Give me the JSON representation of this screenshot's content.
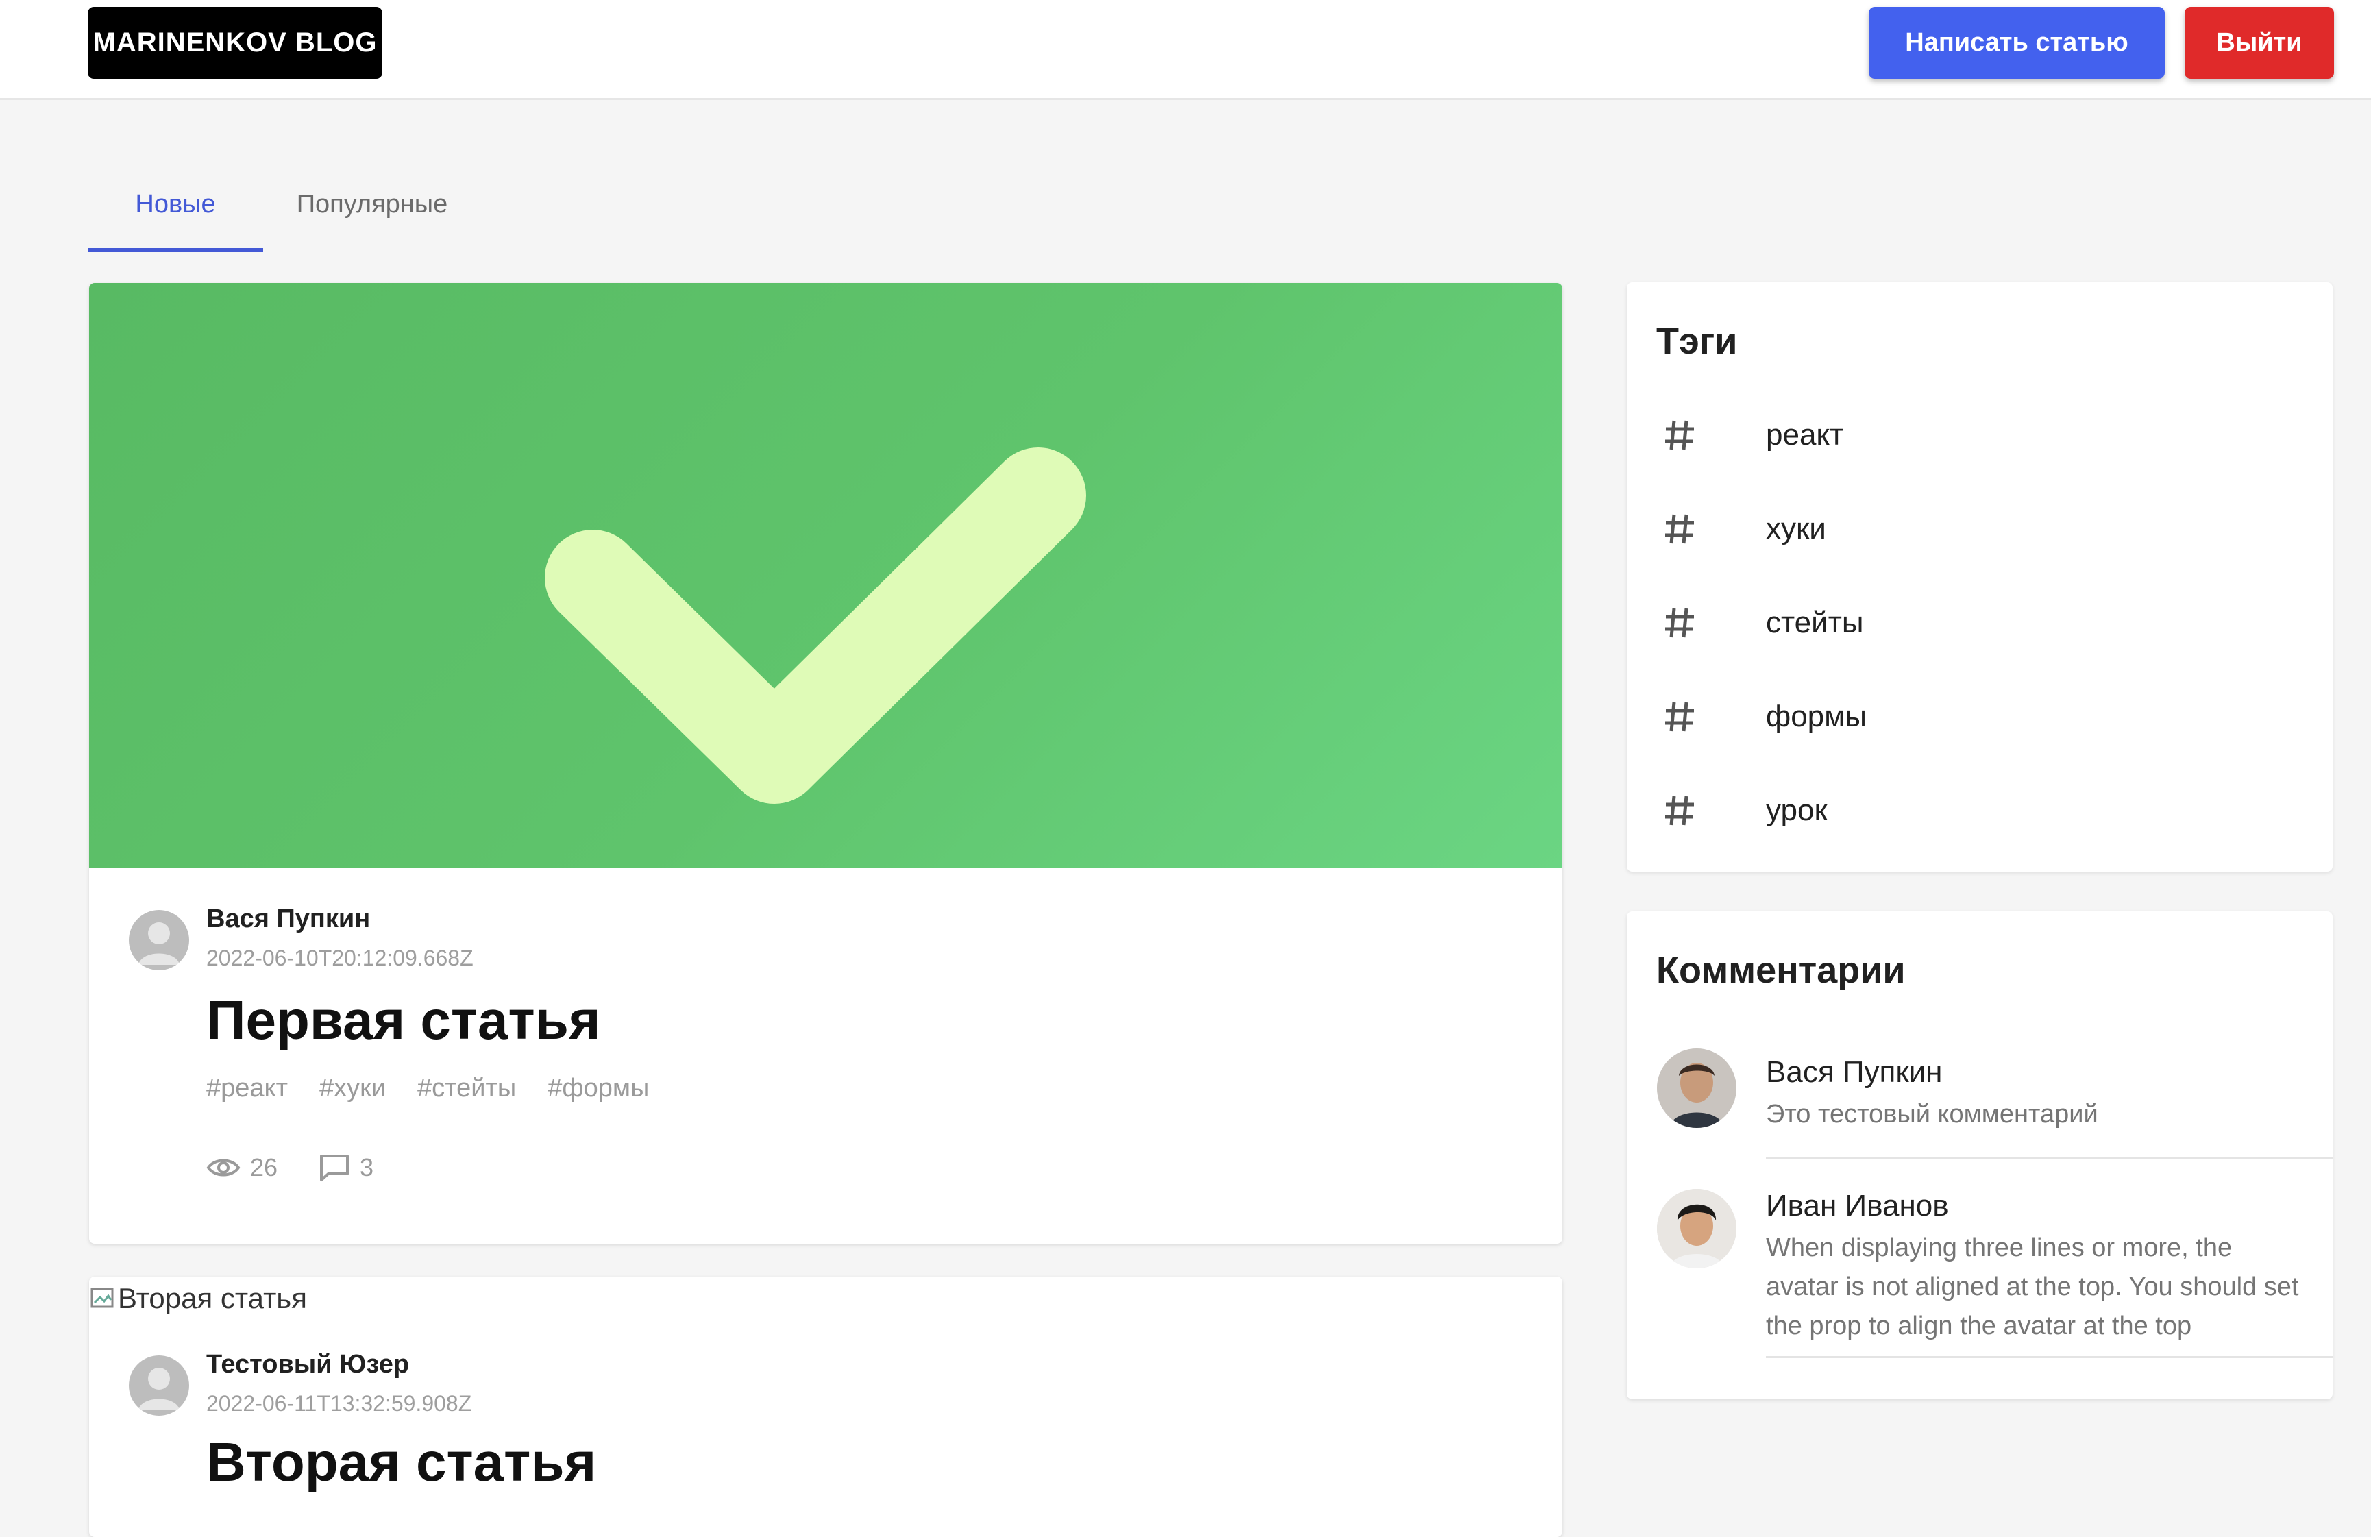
{
  "header": {
    "logo": "MARINENKOV BLOG",
    "write_button": "Написать статью",
    "logout_button": "Выйти",
    "colors": {
      "write": "#4361ee",
      "logout": "#e02a2a"
    }
  },
  "tabs": [
    {
      "label": "Новые",
      "active": true
    },
    {
      "label": "Популярные",
      "active": false
    }
  ],
  "posts": [
    {
      "author": "Вася Пупкин",
      "date": "2022-06-10T20:12:09.668Z",
      "title": "Первая статья",
      "tags": [
        "#реакт",
        "#хуки",
        "#стейты",
        "#формы"
      ],
      "views": "26",
      "comments": "3",
      "cover": "green-checkmark"
    },
    {
      "image_alt": "Вторая статья",
      "author": "Тестовый Юзер",
      "date": "2022-06-11T13:32:59.908Z",
      "title": "Вторая статья"
    }
  ],
  "sidebar": {
    "tags_title": "Тэги",
    "tags": [
      "реакт",
      "хуки",
      "стейты",
      "формы",
      "урок"
    ],
    "comments_title": "Комментарии",
    "comments": [
      {
        "name": "Вася Пупкин",
        "text": "Это тестовый комментарий"
      },
      {
        "name": "Иван Иванов",
        "text": "When displaying three lines or more, the avatar is not aligned at the top. You should set the prop to align the avatar at the top"
      }
    ]
  }
}
